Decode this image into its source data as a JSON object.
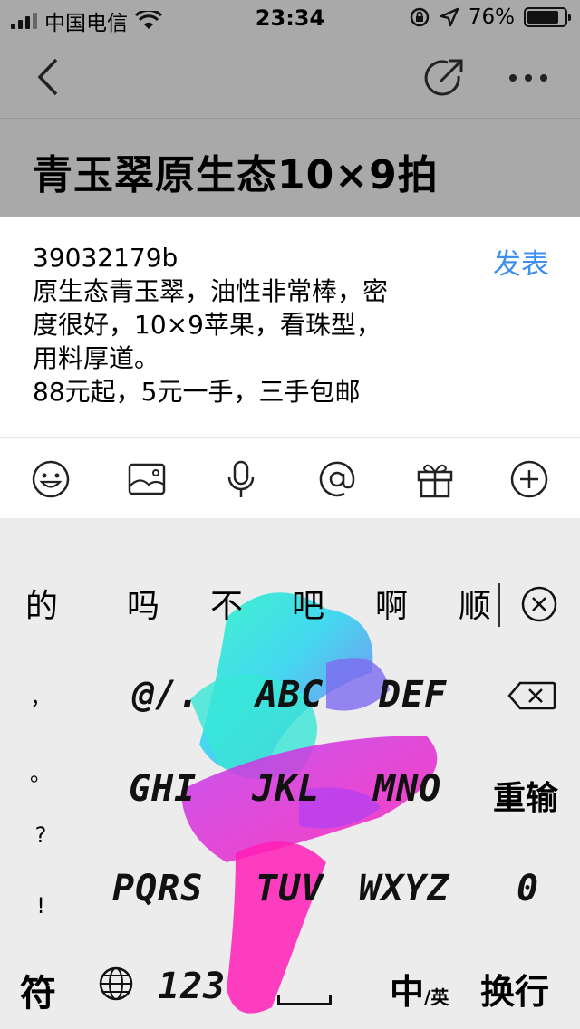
{
  "status_bar": {
    "carrier": "中国电信",
    "time": "23:34",
    "battery_percent": "76%",
    "battery_level": 0.76
  },
  "nav": {
    "back_icon": "chevron-left-icon",
    "share_icon": "share-arrow-icon",
    "more_icon": "more-dots-icon"
  },
  "title": "青玉翠原生态10×9拍",
  "editor": {
    "lines": [
      "39032179b",
      "原生态青玉翠，油性非常棒，密",
      "度很好，10×9苹果，看珠型，",
      "用料厚道。",
      "88元起，5元一手，三手包邮"
    ],
    "publish_label": "发表"
  },
  "toolbar": {
    "icons": [
      "emoji-icon",
      "image-icon",
      "microphone-icon",
      "at-icon",
      "gift-icon",
      "plus-icon"
    ]
  },
  "keyboard": {
    "candidates": [
      "的",
      "吗",
      "不",
      "吧",
      "啊",
      "顺"
    ],
    "punctuation": [
      "，",
      "。",
      "?",
      "!"
    ],
    "row1": [
      "@/.",
      "ABC",
      "DEF"
    ],
    "row2": [
      "GHI",
      "JKL",
      "MNO"
    ],
    "row2_action": "重输",
    "row3": [
      "PQRS",
      "TUV",
      "WXYZ",
      "0"
    ],
    "bottom": {
      "symbols": "符",
      "numbers": "123",
      "lang_main": "中",
      "lang_sub": "/英",
      "return": "换行"
    }
  },
  "colors": {
    "header_bg": "#a9a9a9",
    "publish_blue": "#3d8ff0",
    "keyboard_bg": "#ececec"
  }
}
